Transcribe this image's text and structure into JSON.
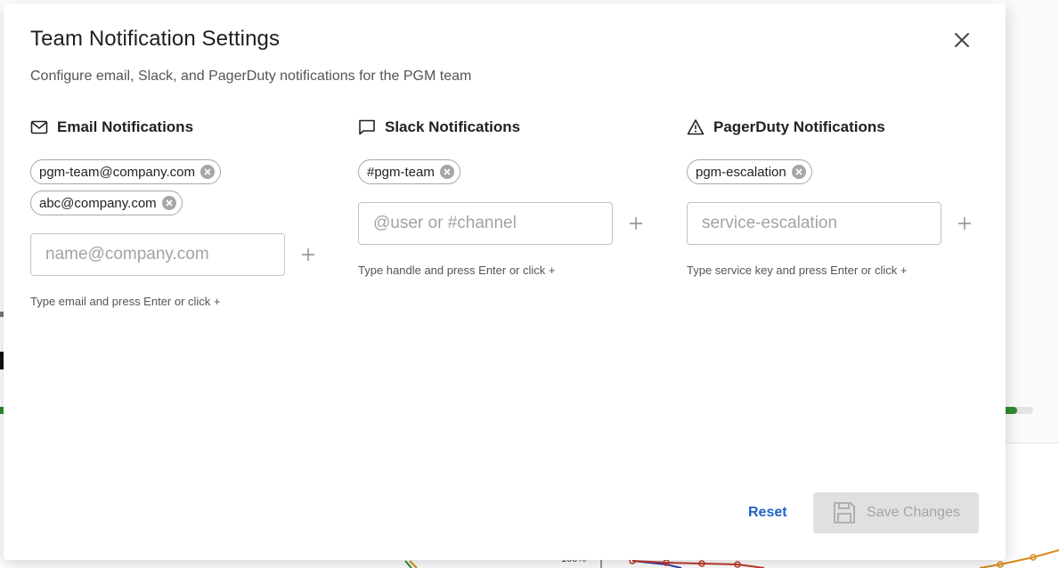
{
  "dialog": {
    "title": "Team Notification Settings",
    "subtitle": "Configure email, Slack, and PagerDuty notifications for the PGM team"
  },
  "email": {
    "header": "Email Notifications",
    "icon": "mail-icon",
    "chips": [
      "pgm-team@company.com",
      "abc@company.com"
    ],
    "placeholder": "name@company.com",
    "value": "",
    "hint": "Type email and press Enter or click +"
  },
  "slack": {
    "header": "Slack Notifications",
    "icon": "chat-bubble-icon",
    "chips": [
      "#pgm-team"
    ],
    "placeholder": "@user or #channel",
    "value": "",
    "hint": "Type handle and press Enter or click +"
  },
  "pagerduty": {
    "header": "PagerDuty Notifications",
    "icon": "warning-triangle-icon",
    "chips": [
      "pgm-escalation"
    ],
    "placeholder": "service-escalation",
    "value": "",
    "hint": "Type service key and press Enter or click +"
  },
  "footer": {
    "reset_label": "Reset",
    "save_label": "Save Changes",
    "save_disabled": true
  },
  "background": {
    "chart_tick": "100%"
  },
  "colors": {
    "accent": "#1f63c7",
    "disabled_bg": "#e0e0e0",
    "disabled_text": "#a4a4a4",
    "progress_fill": "#2e8b2e"
  }
}
